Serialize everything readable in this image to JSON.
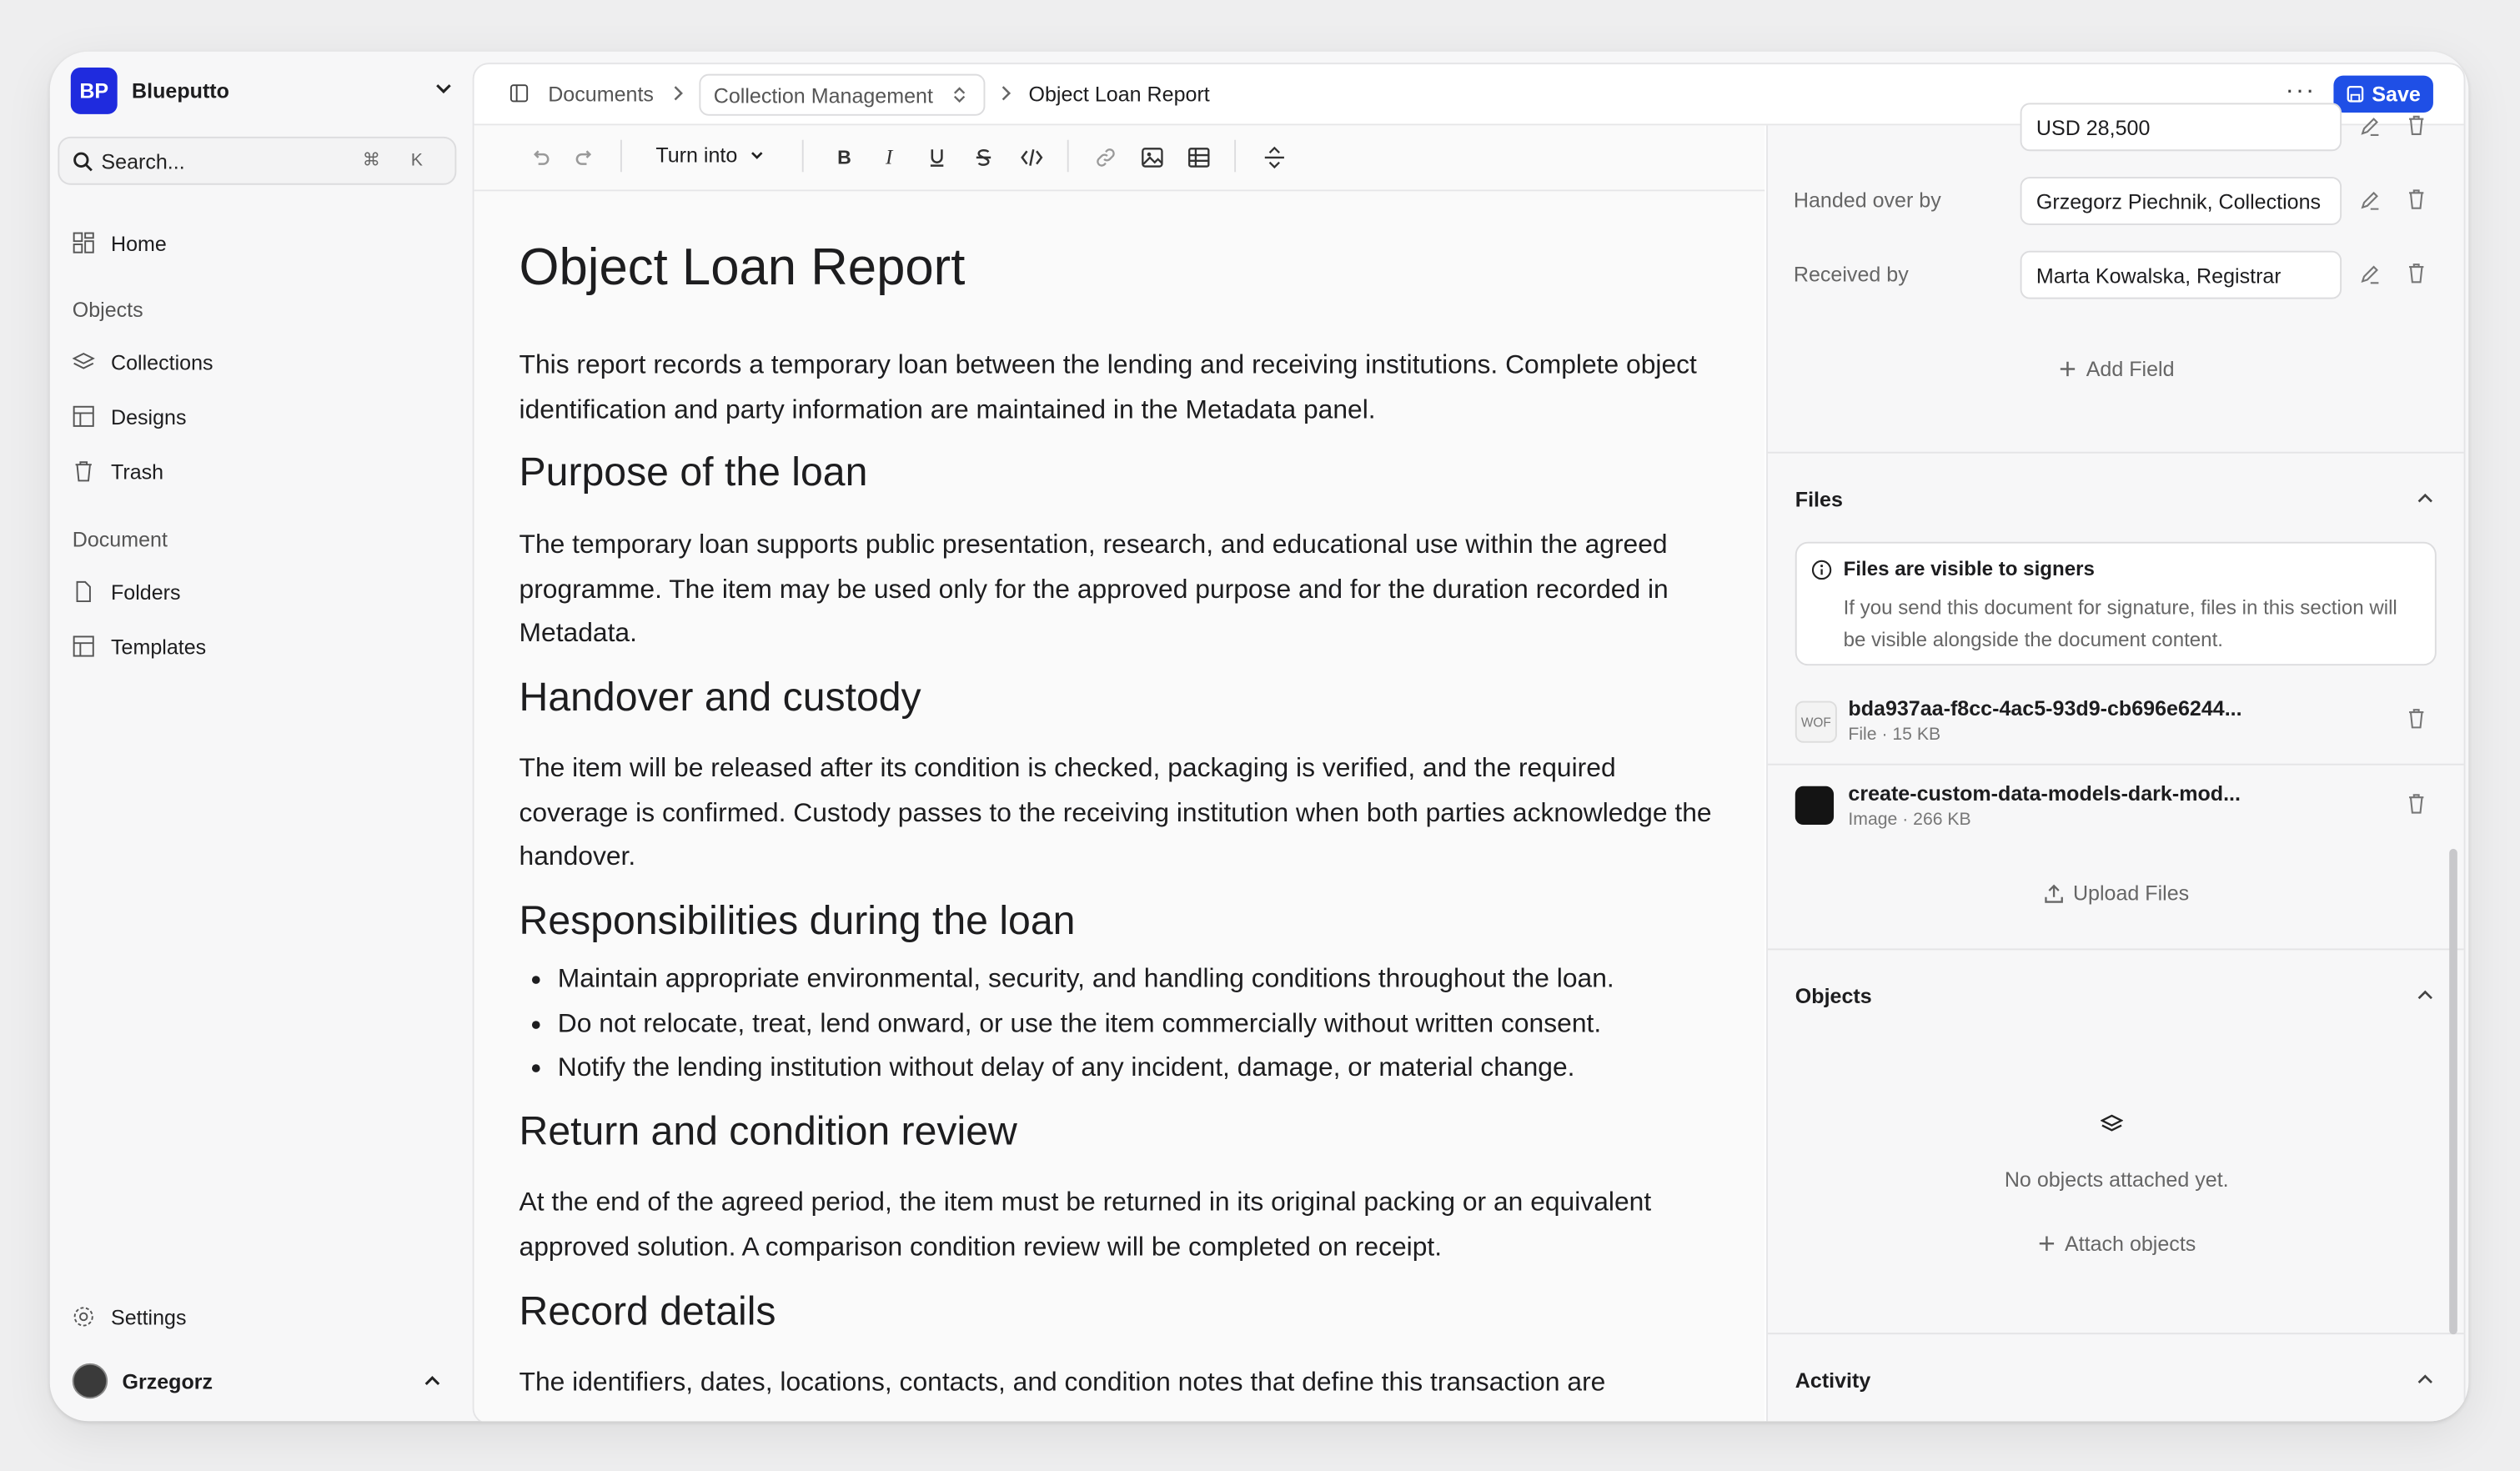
{
  "workspace": {
    "name": "Blueputto",
    "logo_text": "BP"
  },
  "search": {
    "placeholder": "Search...",
    "shortcut": "⌘ K"
  },
  "sidebar": {
    "home": "Home",
    "objects_heading": "Objects",
    "objects_items": [
      "Collections",
      "Designs",
      "Trash"
    ],
    "document_heading": "Document",
    "document_items": [
      "Folders",
      "Templates"
    ],
    "settings": "Settings",
    "user": "Grzegorz"
  },
  "header": {
    "breadcrumb_root": "Documents",
    "breadcrumb_collection": "Collection Management",
    "breadcrumb_current": "Object Loan Report",
    "more": "···",
    "save": "Save"
  },
  "toolbar": {
    "turn_into": "Turn into"
  },
  "document": {
    "title": "Object Loan Report",
    "intro": "This report records a temporary loan between the lending and receiving institutions. Complete object identification and party information are maintained in the Metadata panel.",
    "sections": [
      {
        "heading": "Purpose of the loan",
        "body": "The temporary loan supports public presentation, research, and educational use within the agreed programme. The item may be used only for the approved purpose and for the duration recorded in Metadata."
      },
      {
        "heading": "Handover and custody",
        "body": "The item will be released after its condition is checked, packaging is verified, and the required coverage is confirmed. Custody passes to the receiving institution when both parties acknowledge the handover."
      },
      {
        "heading": "Responsibilities during the loan",
        "bullets": [
          "Maintain appropriate environmental, security, and handling conditions throughout the loan.",
          "Do not relocate, treat, lend onward, or use the item commercially without written consent.",
          "Notify the lending institution without delay of any incident, damage, or material change."
        ]
      },
      {
        "heading": "Return and condition review",
        "body": "At the end of the agreed period, the item must be returned in its original packing or an equivalent approved solution. A comparison condition review will be completed on receipt."
      },
      {
        "heading": "Record details",
        "body": "The identifiers, dates, locations, contacts, and condition notes that define this transaction are"
      }
    ]
  },
  "metadata": {
    "fields": [
      {
        "label": "",
        "value": "USD 28,500"
      },
      {
        "label": "Handed over by",
        "value": "Grzegorz Piechnik, Collections"
      },
      {
        "label": "Received by",
        "value": "Marta Kowalska, Registrar"
      }
    ],
    "add_field": "Add Field"
  },
  "files": {
    "title": "Files",
    "notice_title": "Files are visible to signers",
    "notice_body": "If you send this document for signature, files in this section will be visible alongside the document content.",
    "items": [
      {
        "thumb_text": "WOF",
        "name": "bda937aa-f8cc-4ac5-93d9-cb696e6244...",
        "meta": "File · 15 KB"
      },
      {
        "thumb_text": "",
        "name": "create-custom-data-models-dark-mod...",
        "meta": "Image · 266 KB"
      }
    ],
    "upload": "Upload Files"
  },
  "objects": {
    "title": "Objects",
    "empty": "No objects attached yet.",
    "attach": "Attach objects"
  },
  "activity": {
    "title": "Activity"
  },
  "colors": {
    "accent": "#1f4fe6",
    "logo": "#1f2bde"
  }
}
